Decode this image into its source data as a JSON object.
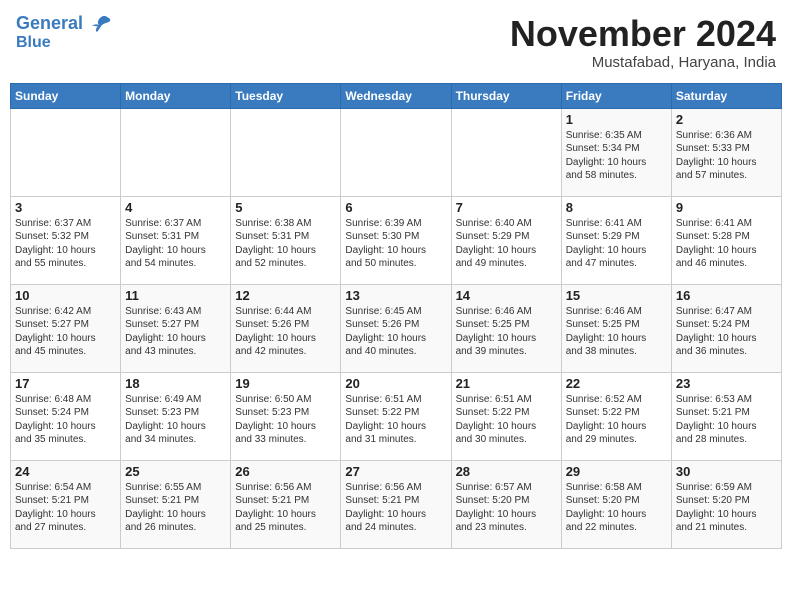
{
  "header": {
    "logo_line1": "General",
    "logo_line2": "Blue",
    "month": "November 2024",
    "location": "Mustafabad, Haryana, India"
  },
  "weekdays": [
    "Sunday",
    "Monday",
    "Tuesday",
    "Wednesday",
    "Thursday",
    "Friday",
    "Saturday"
  ],
  "weeks": [
    [
      {
        "day": "",
        "content": ""
      },
      {
        "day": "",
        "content": ""
      },
      {
        "day": "",
        "content": ""
      },
      {
        "day": "",
        "content": ""
      },
      {
        "day": "",
        "content": ""
      },
      {
        "day": "1",
        "content": "Sunrise: 6:35 AM\nSunset: 5:34 PM\nDaylight: 10 hours\nand 58 minutes."
      },
      {
        "day": "2",
        "content": "Sunrise: 6:36 AM\nSunset: 5:33 PM\nDaylight: 10 hours\nand 57 minutes."
      }
    ],
    [
      {
        "day": "3",
        "content": "Sunrise: 6:37 AM\nSunset: 5:32 PM\nDaylight: 10 hours\nand 55 minutes."
      },
      {
        "day": "4",
        "content": "Sunrise: 6:37 AM\nSunset: 5:31 PM\nDaylight: 10 hours\nand 54 minutes."
      },
      {
        "day": "5",
        "content": "Sunrise: 6:38 AM\nSunset: 5:31 PM\nDaylight: 10 hours\nand 52 minutes."
      },
      {
        "day": "6",
        "content": "Sunrise: 6:39 AM\nSunset: 5:30 PM\nDaylight: 10 hours\nand 50 minutes."
      },
      {
        "day": "7",
        "content": "Sunrise: 6:40 AM\nSunset: 5:29 PM\nDaylight: 10 hours\nand 49 minutes."
      },
      {
        "day": "8",
        "content": "Sunrise: 6:41 AM\nSunset: 5:29 PM\nDaylight: 10 hours\nand 47 minutes."
      },
      {
        "day": "9",
        "content": "Sunrise: 6:41 AM\nSunset: 5:28 PM\nDaylight: 10 hours\nand 46 minutes."
      }
    ],
    [
      {
        "day": "10",
        "content": "Sunrise: 6:42 AM\nSunset: 5:27 PM\nDaylight: 10 hours\nand 45 minutes."
      },
      {
        "day": "11",
        "content": "Sunrise: 6:43 AM\nSunset: 5:27 PM\nDaylight: 10 hours\nand 43 minutes."
      },
      {
        "day": "12",
        "content": "Sunrise: 6:44 AM\nSunset: 5:26 PM\nDaylight: 10 hours\nand 42 minutes."
      },
      {
        "day": "13",
        "content": "Sunrise: 6:45 AM\nSunset: 5:26 PM\nDaylight: 10 hours\nand 40 minutes."
      },
      {
        "day": "14",
        "content": "Sunrise: 6:46 AM\nSunset: 5:25 PM\nDaylight: 10 hours\nand 39 minutes."
      },
      {
        "day": "15",
        "content": "Sunrise: 6:46 AM\nSunset: 5:25 PM\nDaylight: 10 hours\nand 38 minutes."
      },
      {
        "day": "16",
        "content": "Sunrise: 6:47 AM\nSunset: 5:24 PM\nDaylight: 10 hours\nand 36 minutes."
      }
    ],
    [
      {
        "day": "17",
        "content": "Sunrise: 6:48 AM\nSunset: 5:24 PM\nDaylight: 10 hours\nand 35 minutes."
      },
      {
        "day": "18",
        "content": "Sunrise: 6:49 AM\nSunset: 5:23 PM\nDaylight: 10 hours\nand 34 minutes."
      },
      {
        "day": "19",
        "content": "Sunrise: 6:50 AM\nSunset: 5:23 PM\nDaylight: 10 hours\nand 33 minutes."
      },
      {
        "day": "20",
        "content": "Sunrise: 6:51 AM\nSunset: 5:22 PM\nDaylight: 10 hours\nand 31 minutes."
      },
      {
        "day": "21",
        "content": "Sunrise: 6:51 AM\nSunset: 5:22 PM\nDaylight: 10 hours\nand 30 minutes."
      },
      {
        "day": "22",
        "content": "Sunrise: 6:52 AM\nSunset: 5:22 PM\nDaylight: 10 hours\nand 29 minutes."
      },
      {
        "day": "23",
        "content": "Sunrise: 6:53 AM\nSunset: 5:21 PM\nDaylight: 10 hours\nand 28 minutes."
      }
    ],
    [
      {
        "day": "24",
        "content": "Sunrise: 6:54 AM\nSunset: 5:21 PM\nDaylight: 10 hours\nand 27 minutes."
      },
      {
        "day": "25",
        "content": "Sunrise: 6:55 AM\nSunset: 5:21 PM\nDaylight: 10 hours\nand 26 minutes."
      },
      {
        "day": "26",
        "content": "Sunrise: 6:56 AM\nSunset: 5:21 PM\nDaylight: 10 hours\nand 25 minutes."
      },
      {
        "day": "27",
        "content": "Sunrise: 6:56 AM\nSunset: 5:21 PM\nDaylight: 10 hours\nand 24 minutes."
      },
      {
        "day": "28",
        "content": "Sunrise: 6:57 AM\nSunset: 5:20 PM\nDaylight: 10 hours\nand 23 minutes."
      },
      {
        "day": "29",
        "content": "Sunrise: 6:58 AM\nSunset: 5:20 PM\nDaylight: 10 hours\nand 22 minutes."
      },
      {
        "day": "30",
        "content": "Sunrise: 6:59 AM\nSunset: 5:20 PM\nDaylight: 10 hours\nand 21 minutes."
      }
    ]
  ]
}
